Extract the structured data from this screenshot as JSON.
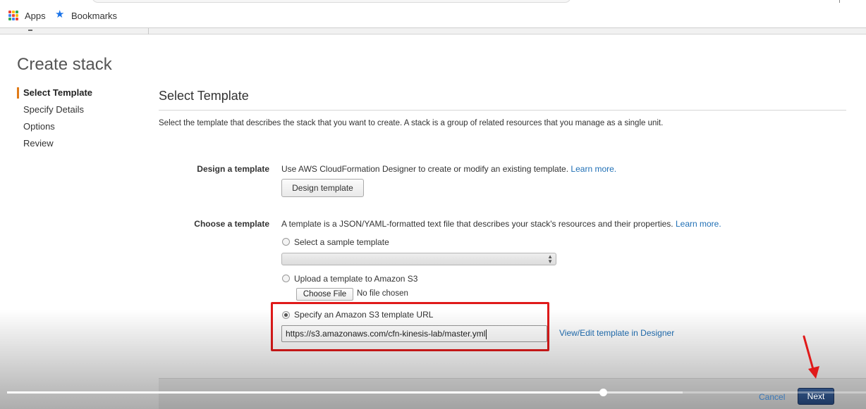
{
  "browser": {
    "bookmarks": [
      {
        "icon": "apps-grid-icon",
        "label": "Apps"
      },
      {
        "icon": "star-icon",
        "label": "Bookmarks"
      }
    ]
  },
  "page": {
    "title": "Create stack",
    "steps": [
      "Select Template",
      "Specify Details",
      "Options",
      "Review"
    ],
    "active_step": "Select Template"
  },
  "section": {
    "title": "Select Template",
    "description": "Select the template that describes the stack that you want to create. A stack is a group of related resources that you manage as a single unit."
  },
  "design": {
    "label": "Design a template",
    "text": "Use AWS CloudFormation Designer to create or modify an existing template.",
    "link": "Learn more.",
    "button": "Design template"
  },
  "choose": {
    "label": "Choose a template",
    "text": "A template is a JSON/YAML-formatted text file that describes your stack's resources and their properties.",
    "link": "Learn more.",
    "options": [
      {
        "label": "Select a sample template",
        "checked": false
      },
      {
        "label": "Upload a template to Amazon S3",
        "checked": false
      },
      {
        "label": "Specify an Amazon S3 template URL",
        "checked": true
      }
    ],
    "sample_select_value": "",
    "file_button": "Choose File",
    "file_status": "No file chosen",
    "url_value": "https://s3.amazonaws.com/cfn-kinesis-lab/master.yml",
    "view_edit_link": "View/Edit template in Designer"
  },
  "footer": {
    "cancel": "Cancel",
    "next": "Next"
  },
  "annotation": {
    "highlight_color": "#e01a1a",
    "arrow_color": "#e01a1a"
  },
  "video": {
    "progress_fraction": 0.694
  },
  "colors": {
    "link": "#1f6fb5",
    "primary_button": "#1f3a63",
    "active_step_accent": "#e07b18"
  }
}
